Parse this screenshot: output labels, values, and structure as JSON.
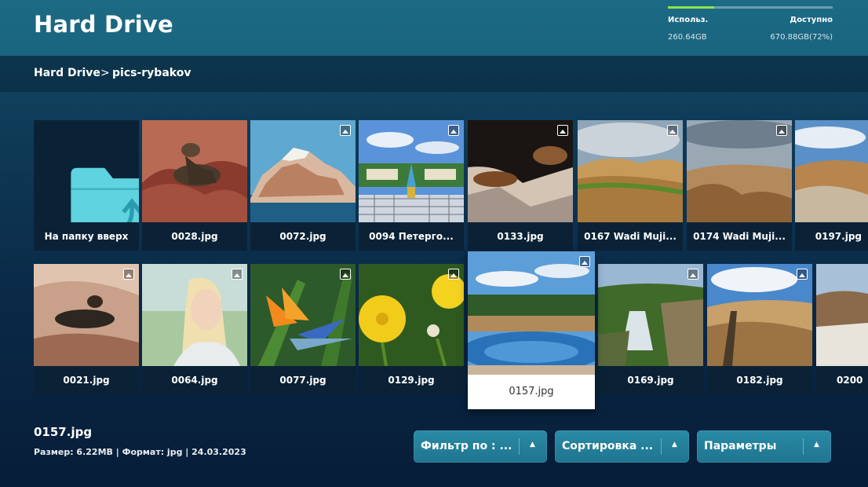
{
  "header": {
    "title": "Hard Drive",
    "storage": {
      "used_label": "Использ.",
      "used_value": "260.64GB",
      "free_label": "Доступно",
      "free_value": "670.88GB(72%)",
      "used_fraction": 0.28,
      "bar_color": "#8ee44b"
    }
  },
  "breadcrumb": {
    "root": "Hard Drive",
    "separator": ">",
    "current": "pics-rybakov"
  },
  "grid": {
    "row1": [
      {
        "label": "На папку вверх",
        "type": "folder-up",
        "icon": "folder-up-icon"
      },
      {
        "label": "0028.jpg"
      },
      {
        "label": "0072.jpg"
      },
      {
        "label": "0094 Петерго..."
      },
      {
        "label": "0133.jpg"
      },
      {
        "label": "0167 Wadi Muji..."
      },
      {
        "label": "0174 Wadi Muji..."
      },
      {
        "label": "0197.jpg"
      }
    ],
    "row2": [
      {
        "label": "0021.jpg"
      },
      {
        "label": "0064.jpg"
      },
      {
        "label": "0077.jpg"
      },
      {
        "label": "0129.jpg"
      },
      {
        "label": "0157.jpg",
        "focused": true
      },
      {
        "label": "0169.jpg"
      },
      {
        "label": "0182.jpg"
      },
      {
        "label": "0200"
      }
    ]
  },
  "selected": {
    "name": "0157.jpg",
    "meta": "Размер: 6.22MB  | Формат: jpg  | 24.03.2023"
  },
  "buttons": {
    "filter": "Фильтр по : ...",
    "sort": "Сортировка ...",
    "params": "Параметры",
    "arrow": "▲"
  },
  "colors": {
    "accent": "#1f7590",
    "folder": "#5fd3df",
    "header": "#1b6782"
  }
}
